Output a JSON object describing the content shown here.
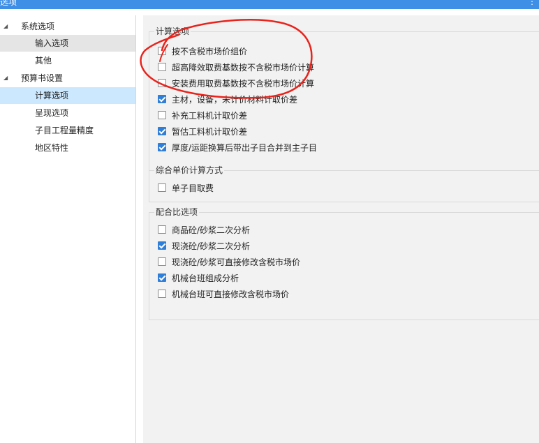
{
  "window": {
    "title": "选项",
    "menu_glyph": "⋮"
  },
  "sidebar": {
    "items": [
      {
        "label": "系统选项",
        "expanded": true,
        "level": 0
      },
      {
        "label": "输入选项",
        "level": 1
      },
      {
        "label": "其他",
        "level": 1
      },
      {
        "label": "预算书设置",
        "expanded": true,
        "level": 0
      },
      {
        "label": "计算选项",
        "level": 1
      },
      {
        "label": "呈现选项",
        "level": 1
      },
      {
        "label": "子目工程量精度",
        "level": 1
      },
      {
        "label": "地区特性",
        "level": 1
      }
    ],
    "expand_glyph": "◢",
    "selected": "计算选项",
    "hovered": "输入选项"
  },
  "groups": {
    "calc": {
      "title": "计算选项",
      "options": [
        {
          "label": "按不含税市场价组价",
          "checked": false
        },
        {
          "label": "超高降效取费基数按不含税市场价计算",
          "checked": false
        },
        {
          "label": "安装费用取费基数按不含税市场价计算",
          "checked": false
        },
        {
          "label": "主材，设备，未计价材料计取价差",
          "checked": true
        },
        {
          "label": "补充工料机计取价差",
          "checked": false
        },
        {
          "label": "暂估工料机计取价差",
          "checked": true
        },
        {
          "label": "厚度/运距换算后带出子目合并到主子目",
          "checked": true
        }
      ]
    },
    "unit_price": {
      "title": "综合单价计算方式",
      "options": [
        {
          "label": "单子目取费",
          "checked": false
        }
      ]
    },
    "mix": {
      "title": "配合比选项",
      "options": [
        {
          "label": "商品砼/砂浆二次分析",
          "checked": false
        },
        {
          "label": "现浇砼/砂浆二次分析",
          "checked": true
        },
        {
          "label": "现浇砼/砂浆可直接修改含税市场价",
          "checked": false
        },
        {
          "label": "机械台班组成分析",
          "checked": true
        },
        {
          "label": "机械台班可直接修改含税市场价",
          "checked": false
        }
      ]
    }
  },
  "colors": {
    "accent": "#2f7fd8",
    "titlebar": "#3f8fe6",
    "selected": "#cce8ff",
    "annotation": "#e8231c"
  }
}
